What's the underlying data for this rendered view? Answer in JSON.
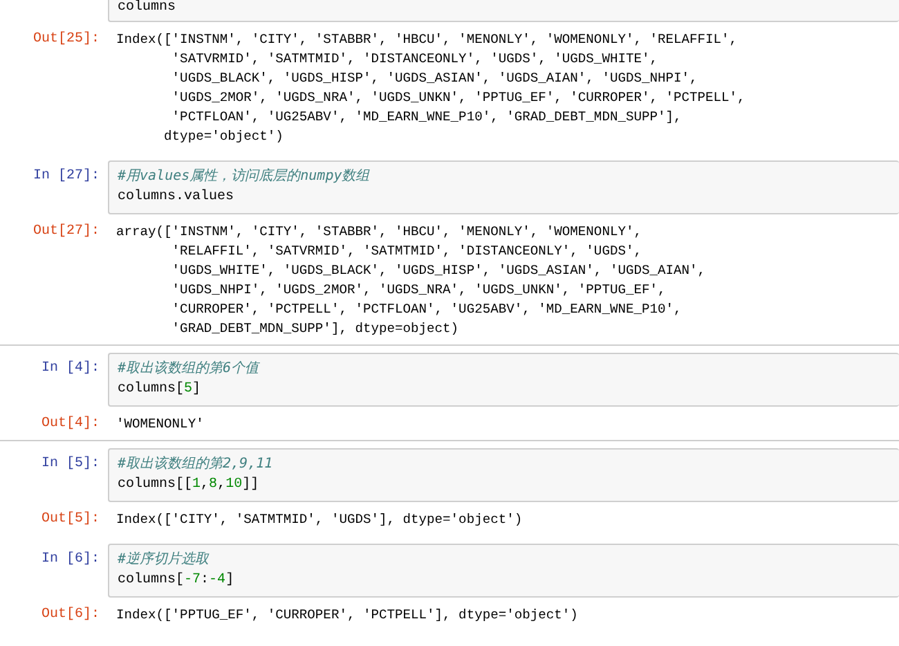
{
  "cells": [
    {
      "rule_above": false,
      "code": [
        [
          {
            "kind": "plain",
            "text": "columns"
          }
        ]
      ],
      "out_prompt": "Out[25]:",
      "output": [
        "Index(['INSTNM', 'CITY', 'STABBR', 'HBCU', 'MENONLY', 'WOMENONLY', 'RELAFFIL',",
        "       'SATVRMID', 'SATMTMID', 'DISTANCEONLY', 'UGDS', 'UGDS_WHITE',",
        "       'UGDS_BLACK', 'UGDS_HISP', 'UGDS_ASIAN', 'UGDS_AIAN', 'UGDS_NHPI',",
        "       'UGDS_2MOR', 'UGDS_NRA', 'UGDS_UNKN', 'PPTUG_EF', 'CURROPER', 'PCTPELL',",
        "       'PCTFLOAN', 'UG25ABV', 'MD_EARN_WNE_P10', 'GRAD_DEBT_MDN_SUPP'],",
        "      dtype='object')"
      ]
    },
    {
      "in_prompt": "In [27]:",
      "rule_above": false,
      "code": [
        [
          {
            "kind": "comment",
            "text": "#用values属性，访问底层的numpy数组"
          }
        ],
        [
          {
            "kind": "plain",
            "text": "columns.values"
          }
        ]
      ],
      "out_prompt": "Out[27]:",
      "output": [
        "array(['INSTNM', 'CITY', 'STABBR', 'HBCU', 'MENONLY', 'WOMENONLY',",
        "       'RELAFFIL', 'SATVRMID', 'SATMTMID', 'DISTANCEONLY', 'UGDS',",
        "       'UGDS_WHITE', 'UGDS_BLACK', 'UGDS_HISP', 'UGDS_ASIAN', 'UGDS_AIAN',",
        "       'UGDS_NHPI', 'UGDS_2MOR', 'UGDS_NRA', 'UGDS_UNKN', 'PPTUG_EF',",
        "       'CURROPER', 'PCTPELL', 'PCTFLOAN', 'UG25ABV', 'MD_EARN_WNE_P10',",
        "       'GRAD_DEBT_MDN_SUPP'], dtype=object)"
      ]
    },
    {
      "in_prompt": "In [4]:",
      "rule_above": true,
      "code": [
        [
          {
            "kind": "comment",
            "text": "#取出该数组的第6个值"
          }
        ],
        [
          {
            "kind": "plain",
            "text": "columns["
          },
          {
            "kind": "number",
            "text": "5"
          },
          {
            "kind": "plain",
            "text": "]"
          }
        ]
      ],
      "out_prompt": "Out[4]:",
      "output": [
        "'WOMENONLY'"
      ]
    },
    {
      "in_prompt": "In [5]:",
      "rule_above": true,
      "code": [
        [
          {
            "kind": "comment",
            "text": "#取出该数组的第2,9,11"
          }
        ],
        [
          {
            "kind": "plain",
            "text": "columns[["
          },
          {
            "kind": "number",
            "text": "1"
          },
          {
            "kind": "plain",
            "text": ","
          },
          {
            "kind": "number",
            "text": "8"
          },
          {
            "kind": "plain",
            "text": ","
          },
          {
            "kind": "number",
            "text": "10"
          },
          {
            "kind": "plain",
            "text": "]]"
          }
        ]
      ],
      "out_prompt": "Out[5]:",
      "output": [
        "Index(['CITY', 'SATMTMID', 'UGDS'], dtype='object')"
      ]
    },
    {
      "in_prompt": "In [6]:",
      "rule_above": false,
      "code": [
        [
          {
            "kind": "comment",
            "text": "#逆序切片选取"
          }
        ],
        [
          {
            "kind": "plain",
            "text": "columns["
          },
          {
            "kind": "number",
            "text": "-7"
          },
          {
            "kind": "plain",
            "text": ":"
          },
          {
            "kind": "number",
            "text": "-4"
          },
          {
            "kind": "plain",
            "text": "]"
          }
        ]
      ],
      "out_prompt": "Out[6]:",
      "output": [
        "Index(['PPTUG_EF', 'CURROPER', 'PCTPELL'], dtype='object')"
      ]
    }
  ]
}
